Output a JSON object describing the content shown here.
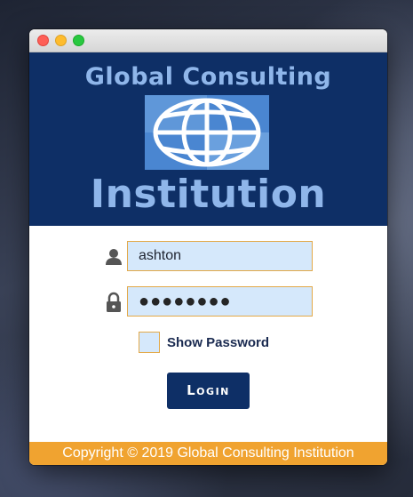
{
  "window": {
    "controls": [
      "close",
      "minimize",
      "zoom"
    ]
  },
  "banner": {
    "line1": "Global Consulting",
    "line2": "Institution",
    "logo_icon": "globe-icon",
    "background": "#0e2f66",
    "text_color": "#8fb6ea"
  },
  "form": {
    "username": {
      "icon": "user-icon",
      "value": "ashton"
    },
    "password": {
      "icon": "lock-icon",
      "masked_value": "●●●●●●●●"
    },
    "show_password": {
      "label": "Show Password",
      "checked": false
    },
    "login_button": {
      "label": "Login"
    }
  },
  "footer": {
    "text": "Copyright © 2019 Global Consulting Institution",
    "background": "#f0a330"
  }
}
